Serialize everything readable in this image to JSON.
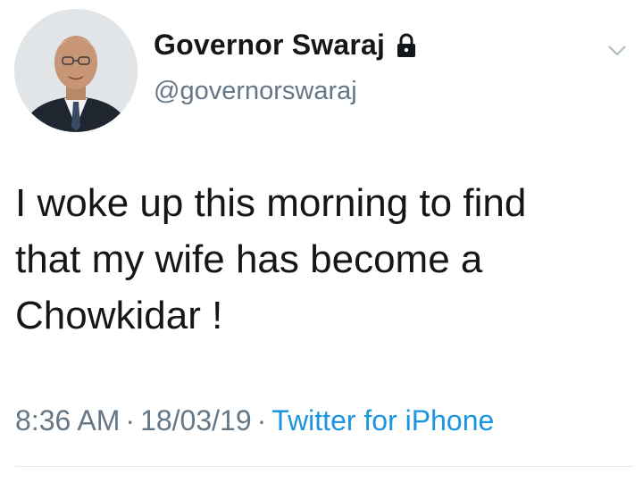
{
  "user": {
    "display_name": "Governor Swaraj",
    "handle": "@governorswaraj",
    "protected_icon": "lock-icon",
    "avatar_icon": "profile-photo"
  },
  "tweet": {
    "lines": [
      "I woke up this morning to find",
      "that my wife has become a",
      "Chowkidar !"
    ]
  },
  "meta": {
    "time": "8:36 AM",
    "separator": "·",
    "date": "18/03/19",
    "source": "Twitter for iPhone"
  },
  "colors": {
    "primary_text": "#14171a",
    "secondary_text": "#657786",
    "link": "#1b95e0"
  },
  "menu_icon": "chevron-down-icon"
}
